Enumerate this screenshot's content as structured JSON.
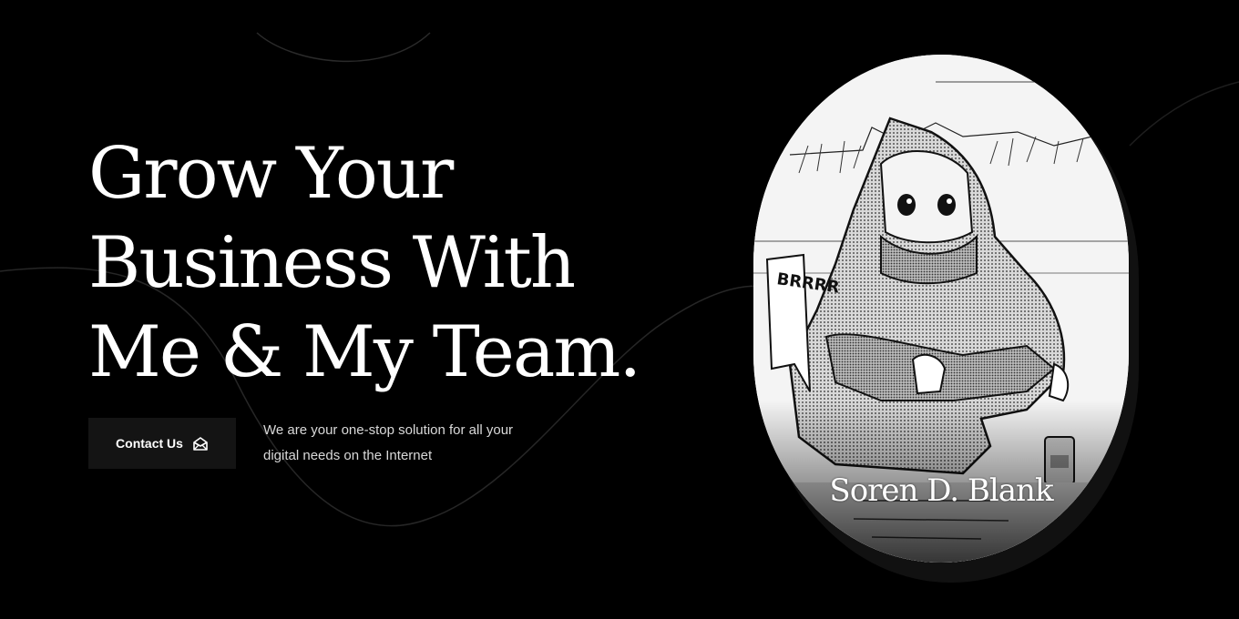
{
  "hero": {
    "headline_lines": [
      "Grow Your",
      "Business With",
      "Me & My Team."
    ],
    "contact_button": {
      "label": "Contact Us",
      "icon": "envelope-open-icon"
    },
    "tagline": "We are your one-stop solution for all your digital needs on the Internet"
  },
  "portrait": {
    "name": "Soren D. Blank",
    "image": "manga-illustration-hooded-figure-crouching",
    "sound_effect": "BRRRR"
  },
  "colors": {
    "background": "#000000",
    "button_bg": "#141414",
    "text": "#ffffff",
    "tagline_text": "#d9d9d9"
  }
}
